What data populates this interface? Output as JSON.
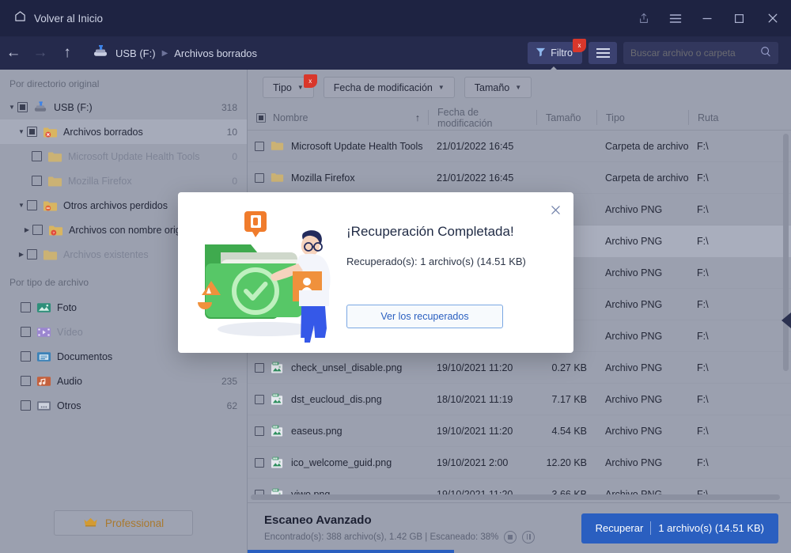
{
  "titlebar": {
    "home_label": "Volver al Inicio",
    "icons": [
      "share-icon",
      "menu-icon",
      "minimize-icon",
      "maximize-icon",
      "close-icon"
    ]
  },
  "navbar": {
    "back": "←",
    "forward": "→",
    "up": "↑",
    "crumbs": [
      "USB (F:)",
      "Archivos borrados"
    ],
    "crumb_sep": "▶",
    "filter_label": "Filtro",
    "filter_badge": "x",
    "search_placeholder": "Buscar archivo o carpeta",
    "search_value": ""
  },
  "sidebar": {
    "section_dir": "Por directorio original",
    "section_type": "Por tipo de archivo",
    "tree": [
      {
        "label": "USB (F:)",
        "count": "318",
        "indent": 0,
        "expander": "▼",
        "check": "filled",
        "icon": "usb-drive-icon",
        "selected": false,
        "dim": false
      },
      {
        "label": "Archivos borrados",
        "count": "10",
        "indent": 1,
        "expander": "▼",
        "check": "filled",
        "icon": "deleted-folder-icon",
        "selected": true,
        "dim": false
      },
      {
        "label": "Microsoft Update Health Tools",
        "count": "0",
        "indent": 2,
        "expander": "",
        "check": "empty",
        "icon": "folder-icon",
        "selected": false,
        "dim": true
      },
      {
        "label": "Mozilla Firefox",
        "count": "0",
        "indent": 2,
        "expander": "",
        "check": "empty",
        "icon": "folder-icon",
        "selected": false,
        "dim": true
      },
      {
        "label": "Otros archivos perdidos",
        "count": "",
        "indent": 1,
        "expander": "▼",
        "check": "empty",
        "icon": "lost-folder-icon",
        "selected": false,
        "dim": false
      },
      {
        "label": "Archivos con nombre original",
        "count": "",
        "indent": 2,
        "expander": "▶",
        "check": "empty",
        "icon": "unknown-folder-icon",
        "selected": false,
        "dim": false
      },
      {
        "label": "Archivos existentes",
        "count": "",
        "indent": 1,
        "expander": "▶",
        "check": "empty",
        "icon": "folder-icon",
        "selected": false,
        "dim": true
      }
    ],
    "types": [
      {
        "label": "Foto",
        "count": "",
        "icon": "photo-icon",
        "dim": false
      },
      {
        "label": "Vídeo",
        "count": "",
        "icon": "video-icon",
        "dim": true
      },
      {
        "label": "Documentos",
        "count": "",
        "icon": "documents-icon",
        "dim": false
      },
      {
        "label": "Audio",
        "count": "235",
        "icon": "audio-icon",
        "dim": false
      },
      {
        "label": "Otros",
        "count": "62",
        "icon": "others-icon",
        "dim": false
      }
    ],
    "pro_label": "Professional"
  },
  "filterbar": {
    "chips": [
      {
        "label": "Tipo",
        "badge": "x"
      },
      {
        "label": "Fecha de modificación",
        "badge": ""
      },
      {
        "label": "Tamaño",
        "badge": ""
      }
    ]
  },
  "table": {
    "columns": [
      "Nombre",
      "Fecha de modificación",
      "Tamaño",
      "Tipo",
      "Ruta"
    ],
    "sort_indicator": "↑",
    "rows": [
      {
        "name": "Microsoft Update Health Tools",
        "date": "21/01/2022 16:45",
        "size": "",
        "type": "Carpeta de archivos",
        "path": "F:\\",
        "icon": "folder-icon",
        "highlight": false
      },
      {
        "name": "Mozilla Firefox",
        "date": "21/01/2022 16:45",
        "size": "",
        "type": "Carpeta de archivos",
        "path": "F:\\",
        "icon": "folder-icon",
        "highlight": false
      },
      {
        "name": "",
        "date": "",
        "size": "",
        "type": "Archivo PNG",
        "path": "F:\\",
        "icon": "png-icon",
        "highlight": false
      },
      {
        "name": "",
        "date": "",
        "size": "",
        "type": "Archivo PNG",
        "path": "F:\\",
        "icon": "png-icon",
        "highlight": true
      },
      {
        "name": "",
        "date": "",
        "size": "",
        "type": "Archivo PNG",
        "path": "F:\\",
        "icon": "png-icon",
        "highlight": false
      },
      {
        "name": "",
        "date": "",
        "size": "",
        "type": "Archivo PNG",
        "path": "F:\\",
        "icon": "png-icon",
        "highlight": false
      },
      {
        "name": "",
        "date": "",
        "size": "",
        "type": "Archivo PNG",
        "path": "F:\\",
        "icon": "png-icon",
        "highlight": false
      },
      {
        "name": "check_unsel_disable.png",
        "date": "19/10/2021 11:20",
        "size": "0.27 KB",
        "type": "Archivo PNG",
        "path": "F:\\",
        "icon": "png-icon",
        "highlight": false
      },
      {
        "name": "dst_eucloud_dis.png",
        "date": "18/10/2021 11:19",
        "size": "7.17 KB",
        "type": "Archivo PNG",
        "path": "F:\\",
        "icon": "png-icon",
        "highlight": false
      },
      {
        "name": "easeus.png",
        "date": "19/10/2021 11:20",
        "size": "4.54 KB",
        "type": "Archivo PNG",
        "path": "F:\\",
        "icon": "png-icon",
        "highlight": false
      },
      {
        "name": "ico_welcome_guid.png",
        "date": "19/10/2021 2:00",
        "size": "12.20 KB",
        "type": "Archivo PNG",
        "path": "F:\\",
        "icon": "png-icon",
        "highlight": false
      },
      {
        "name": "yiwo.png",
        "date": "19/10/2021 11:20",
        "size": "3.66 KB",
        "type": "Archivo PNG",
        "path": "F:\\",
        "icon": "png-icon",
        "highlight": false
      }
    ]
  },
  "status": {
    "title": "Escaneo Avanzado",
    "subtitle": "Encontrado(s): 388 archivo(s), 1.42 GB | Escaneado: 38%",
    "stop_icon": "stop-icon",
    "pause_icon": "pause-icon",
    "recover_label": "Recuperar",
    "recover_detail": "1 archivo(s) (14.51 KB)",
    "progress_percent": 38
  },
  "modal": {
    "title": "¡Recuperación Completada!",
    "message": "Recuperado(s): 1 archivo(s) (14.51 KB)",
    "button_label": "Ver los recuperados",
    "close_icon": "close-icon",
    "illustration": "recovery-complete-illustration"
  },
  "colors": {
    "accent_blue": "#2a5fc0",
    "titlebar_bg": "#1e2342",
    "navbar_bg": "#252a4c",
    "panel_bg": "#9ba0af",
    "badge_red": "#d9372b",
    "pro_gold": "#a9792f",
    "success_green": "#4caf50"
  }
}
